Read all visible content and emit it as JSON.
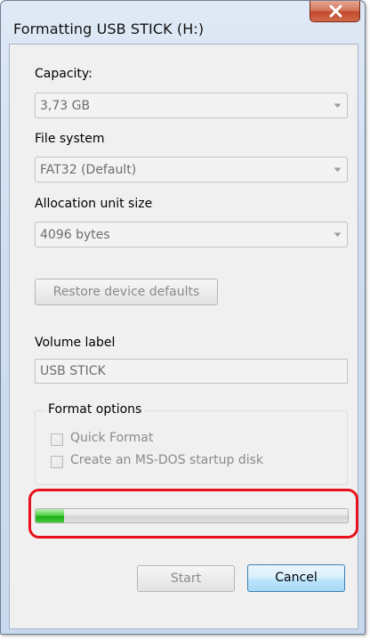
{
  "window": {
    "title": "Formatting USB STICK (H:)",
    "close_glyph": "×"
  },
  "capacity": {
    "label": "Capacity:",
    "value": "3,73 GB"
  },
  "file_system": {
    "label": "File system",
    "value": "FAT32 (Default)"
  },
  "allocation": {
    "label": "Allocation unit size",
    "value": "4096 bytes"
  },
  "restore_button": {
    "label": "Restore device defaults"
  },
  "volume": {
    "label": "Volume label",
    "value": "USB STICK"
  },
  "format_options": {
    "legend": "Format options",
    "quick_format": "Quick Format",
    "msdos_disk": "Create an MS-DOS startup disk"
  },
  "progress": {
    "fraction": 0.09
  },
  "buttons": {
    "start": "Start",
    "cancel": "Cancel"
  },
  "colors": {
    "highlight": "#e8101a",
    "progress": "#1fae17",
    "close": "#c04a2b"
  },
  "icons": {
    "close": "close-icon",
    "dropdown": "chevron-down-icon"
  }
}
